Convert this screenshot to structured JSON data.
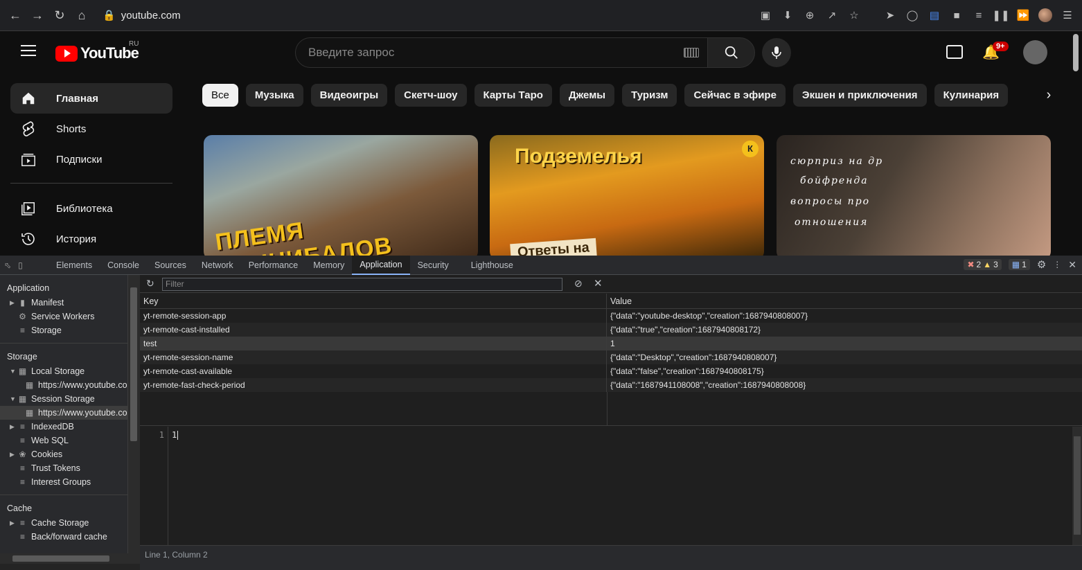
{
  "browser": {
    "url": "youtube.com",
    "back_icon": "arrow-left",
    "forward_icon": "arrow-right",
    "reload_icon": "reload",
    "home_icon": "home"
  },
  "youtube": {
    "logo_text": "YouTube",
    "region": "RU",
    "search_placeholder": "Введите запрос",
    "notifications_badge": "9+",
    "sidebar": [
      {
        "label": "Главная",
        "icon": "home-icon",
        "active": true
      },
      {
        "label": "Shorts",
        "icon": "shorts-icon"
      },
      {
        "label": "Подписки",
        "icon": "subscriptions-icon"
      },
      {
        "label": "Библиотека",
        "icon": "library-icon"
      },
      {
        "label": "История",
        "icon": "history-icon"
      }
    ],
    "chips": [
      "Все",
      "Музыка",
      "Видеоигры",
      "Скетч-шоу",
      "Карты Таро",
      "Джемы",
      "Туризм",
      "Сейчас в эфире",
      "Экшен и приключения",
      "Кулинария"
    ],
    "thumbs": {
      "t1_caption": "ПЛЕМЯ КАННИБАЛОВ",
      "t2_caption": "Подземелья",
      "t2_caption2": "Ответы на",
      "t3_lines": [
        "сюрприз на др",
        "бойфренда",
        "вопросы про",
        "отношения"
      ]
    }
  },
  "devtools": {
    "tabs": [
      "Elements",
      "Console",
      "Sources",
      "Network",
      "Performance",
      "Memory",
      "Application",
      "Security",
      "Lighthouse"
    ],
    "active_tab": "Application",
    "errors": "2",
    "warnings": "3",
    "messages": "1",
    "sidebar": {
      "application_header": "Application",
      "application_items": [
        "Manifest",
        "Service Workers",
        "Storage"
      ],
      "storage_header": "Storage",
      "local_storage": "Local Storage",
      "local_storage_origin": "https://www.youtube.co",
      "session_storage": "Session Storage",
      "session_storage_origin": "https://www.youtube.co",
      "storage_items": [
        "IndexedDB",
        "Web SQL",
        "Cookies",
        "Trust Tokens",
        "Interest Groups"
      ],
      "cache_header": "Cache",
      "cache_items": [
        "Cache Storage",
        "Back/forward cache"
      ]
    },
    "filter_placeholder": "Filter",
    "table": {
      "key_header": "Key",
      "value_header": "Value",
      "rows": [
        {
          "key": "yt-remote-session-app",
          "value": "{\"data\":\"youtube-desktop\",\"creation\":1687940808007}"
        },
        {
          "key": "yt-remote-cast-installed",
          "value": "{\"data\":\"true\",\"creation\":1687940808172}"
        },
        {
          "key": "test",
          "value": "1"
        },
        {
          "key": "yt-remote-session-name",
          "value": "{\"data\":\"Desktop\",\"creation\":1687940808007}"
        },
        {
          "key": "yt-remote-cast-available",
          "value": "{\"data\":\"false\",\"creation\":1687940808175}"
        },
        {
          "key": "yt-remote-fast-check-period",
          "value": "{\"data\":\"1687941108008\",\"creation\":1687940808008}"
        }
      ],
      "selected_row": 2
    },
    "editor": {
      "line_number": "1",
      "content": "1"
    },
    "status": "Line 1, Column 2"
  }
}
